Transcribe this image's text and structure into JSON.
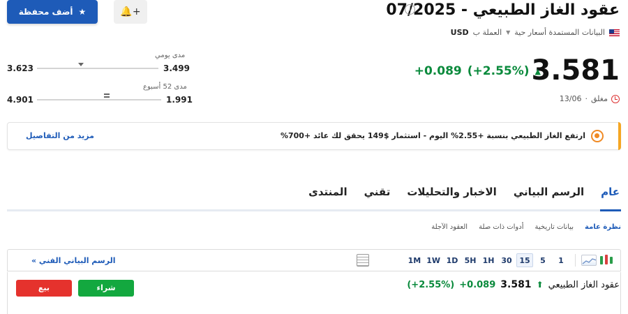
{
  "header": {
    "title": "عقود الغاز الطبيعي - 07/2025",
    "info_icon": "i",
    "data_source": "البيانات المستمدة أسعار حية",
    "currency_label": "العملة ب",
    "currency": "USD"
  },
  "actions": {
    "add_portfolio": "أضف محفظة",
    "alert_icon_text": "🔔+"
  },
  "quote": {
    "price": "3.581",
    "change": "+0.089",
    "change_pct": "(+2.55%)",
    "status": "مغلق",
    "date": "13/06"
  },
  "ranges": {
    "daily": {
      "label": "مدى يومي",
      "low": "3.499",
      "high": "3.623",
      "marker_position": 0.36
    },
    "week52": {
      "label": "مدى 52 أسبوع",
      "low": "1.991",
      "high": "4.901",
      "marker_position": 0.56
    }
  },
  "banner": {
    "text": "ارتفع الغاز الطبيعي بنسبة +2.55% اليوم - استثمار $149 يحقق لك عائد +700%",
    "link": "مزيد من التفاصيل"
  },
  "tabs": [
    {
      "label": "عام",
      "active": true
    },
    {
      "label": "الرسم البياني",
      "active": false
    },
    {
      "label": "الاخبار والتحليلات",
      "active": false
    },
    {
      "label": "تقني",
      "active": false
    },
    {
      "label": "المنتدى",
      "active": false
    }
  ],
  "subtabs": [
    {
      "label": "نظرة عامة",
      "active": true
    },
    {
      "label": "بيانات تاريخية",
      "active": false
    },
    {
      "label": "أدوات ذات صلة",
      "active": false
    },
    {
      "label": "العقود الآجلة",
      "active": false
    }
  ],
  "chart_toolbar": {
    "intervals": [
      "1",
      "5",
      "15",
      "30",
      "1H",
      "5H",
      "1D",
      "1W",
      "1M"
    ],
    "active_interval": "15",
    "technical_link": "الرسم البياني الفني »"
  },
  "bottom": {
    "name": "عقود الغاز الطبيعي",
    "price": "3.581",
    "change": "+0.089",
    "change_pct": "(+2.55%)",
    "buy": "شراء",
    "sell": "بيع"
  },
  "colors": {
    "accent": "#1e5bb8",
    "positive": "#0a8a3c",
    "buy": "#13a83f",
    "sell": "#e5322d",
    "banner_edge": "#f5a623"
  }
}
